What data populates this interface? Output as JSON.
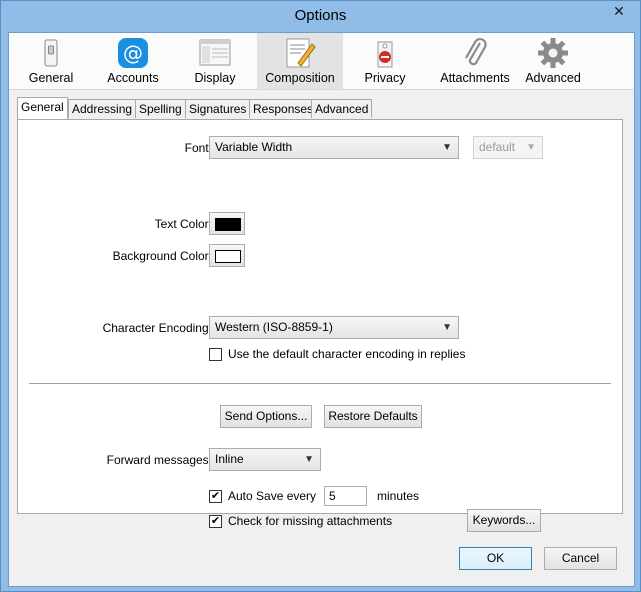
{
  "window": {
    "title": "Options",
    "close_glyph": "✕"
  },
  "toolbar": {
    "items": [
      {
        "label": "General",
        "icon": "switch-icon"
      },
      {
        "label": "Accounts",
        "icon": "at-sign-icon"
      },
      {
        "label": "Display",
        "icon": "window-icon"
      },
      {
        "label": "Composition",
        "icon": "pen-page-icon",
        "selected": true
      },
      {
        "label": "Privacy",
        "icon": "privacy-tag-icon"
      },
      {
        "label": "Attachments",
        "icon": "paperclip-icon"
      },
      {
        "label": "Advanced",
        "icon": "gear-icon"
      }
    ]
  },
  "tabs": [
    "General",
    "Addressing",
    "Spelling",
    "Signatures",
    "Responses",
    "Advanced"
  ],
  "active_tab": "General",
  "font": {
    "label": "Font:",
    "value": "Variable Width",
    "size_value": "default"
  },
  "text_color": {
    "label": "Text Color:",
    "color": "#000000"
  },
  "background_color": {
    "label": "Background Color:",
    "color": "#ffffff"
  },
  "encoding": {
    "label": "Character Encoding:",
    "value": "Western (ISO-8859-1)",
    "use_default_label": "Use the default character encoding in replies",
    "use_default_checked": false
  },
  "buttons": {
    "send_options": "Send Options...",
    "restore_defaults": "Restore Defaults",
    "keywords": "Keywords...",
    "ok": "OK",
    "cancel": "Cancel"
  },
  "forward": {
    "label": "Forward messages:",
    "value": "Inline"
  },
  "autosave": {
    "label": "Auto Save every",
    "value": "5",
    "unit": "minutes",
    "checked": true
  },
  "missing_attachments": {
    "label": "Check for missing attachments",
    "checked": true
  },
  "colors": {
    "accent": "#3c7fb1",
    "titlebar": "#8fbde8"
  }
}
